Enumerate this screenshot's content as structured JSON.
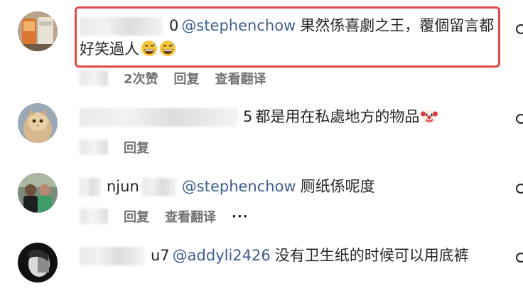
{
  "comments": [
    {
      "username_tail": "0",
      "mention": "@stephenchow",
      "text": "果然係喜劇之王，覆個留言都好笑過人",
      "emoji": [
        "grinning-sweat-emoji",
        "grinning-sweat-emoji"
      ],
      "likes_label": "2次赞",
      "reply_label": "回复",
      "translate_label": "查看翻译"
    },
    {
      "username_tail": "5",
      "mention": "",
      "text": "都是用在私處地方的物品",
      "emoji": [
        "clown-emoji"
      ],
      "reply_label": "回复"
    },
    {
      "username_tail": "njun",
      "mention": "@stephenchow",
      "text": "厕纸係呢度",
      "reply_label": "回复",
      "translate_label": "查看翻译",
      "more_label": "···"
    },
    {
      "username_tail": "u7",
      "mention": "@addyli2426",
      "text": "没有卫生纸的时候可以用底裤"
    }
  ],
  "colors": {
    "highlight": "#e0484a",
    "mention": "#3d5f8f",
    "meta": "#737373"
  }
}
